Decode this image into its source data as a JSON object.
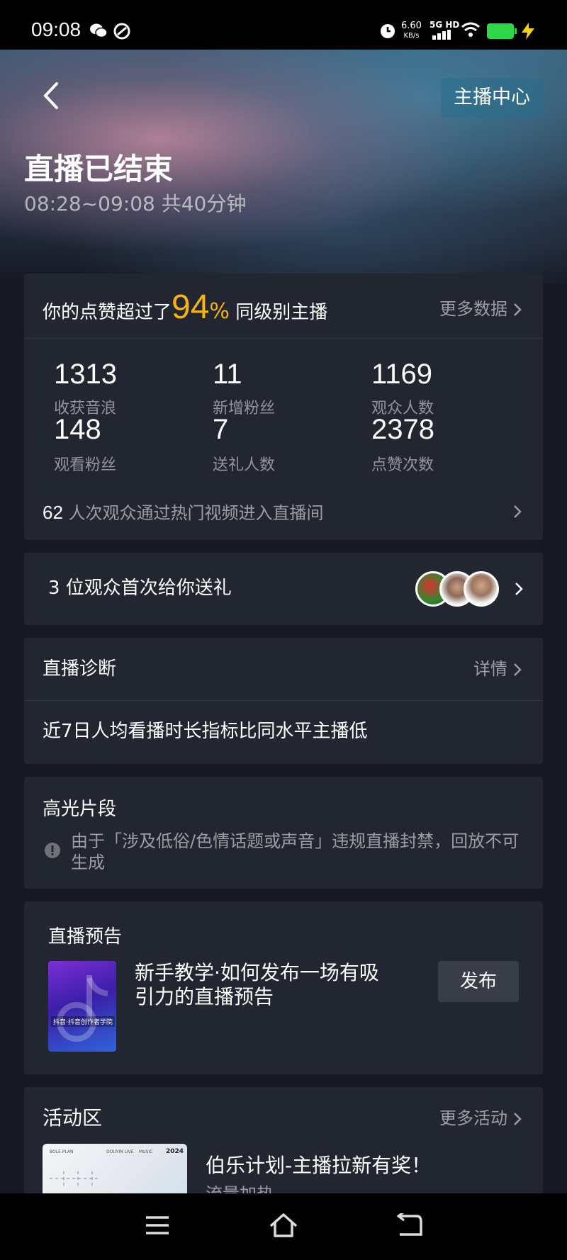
{
  "status_bar": {
    "time": "09:08",
    "net_speed": "6.60",
    "net_unit": "KB/s",
    "network": "5G HD"
  },
  "header": {
    "back_label": "<",
    "anchor_center": "主播中心",
    "title": "直播已结束",
    "time_range": "08:28~09:08 共40分钟"
  },
  "likes_card": {
    "prefix": "你的点赞超过了",
    "percent": "94",
    "percent_sign": "%",
    "suffix": "同级别主播",
    "more_data": "更多数据",
    "stats": [
      {
        "value": "1313",
        "label": "收获音浪"
      },
      {
        "value": "11",
        "label": "新增粉丝"
      },
      {
        "value": "1169",
        "label": "观众人数"
      },
      {
        "value": "148",
        "label": "观看粉丝"
      },
      {
        "value": "7",
        "label": "送礼人数"
      },
      {
        "value": "2378",
        "label": "点赞次数"
      }
    ],
    "hot_count": "62",
    "hot_text": "人次观众通过热门视频进入直播间"
  },
  "gift_card": {
    "text": "3 位观众首次给你送礼"
  },
  "diagnosis": {
    "title": "直播诊断",
    "detail": "详情",
    "message": "近7日人均看播时长指标比同水平主播低"
  },
  "highlight": {
    "title": "高光片段",
    "notice": "由于「涉及低俗/色情话题或声音」违规直播封禁，回放不可生成"
  },
  "preview": {
    "title": "直播预告",
    "tutorial": "新手教学·如何发布一场有吸引力的直播预告",
    "publish": "发布",
    "thumb_label": "抖音·抖音创作者学院"
  },
  "activity": {
    "title": "活动区",
    "more": "更多活动",
    "item_title": "伯乐计划-主播拉新有奖！",
    "item_sub": "流量加热",
    "thumb_texts": [
      "BOLE PLAN",
      "DOUYIN LIVE",
      "MUSIC",
      "2024"
    ]
  },
  "colors": {
    "accent": "#f5b21a",
    "bg": "#161823",
    "card": "#222630"
  }
}
